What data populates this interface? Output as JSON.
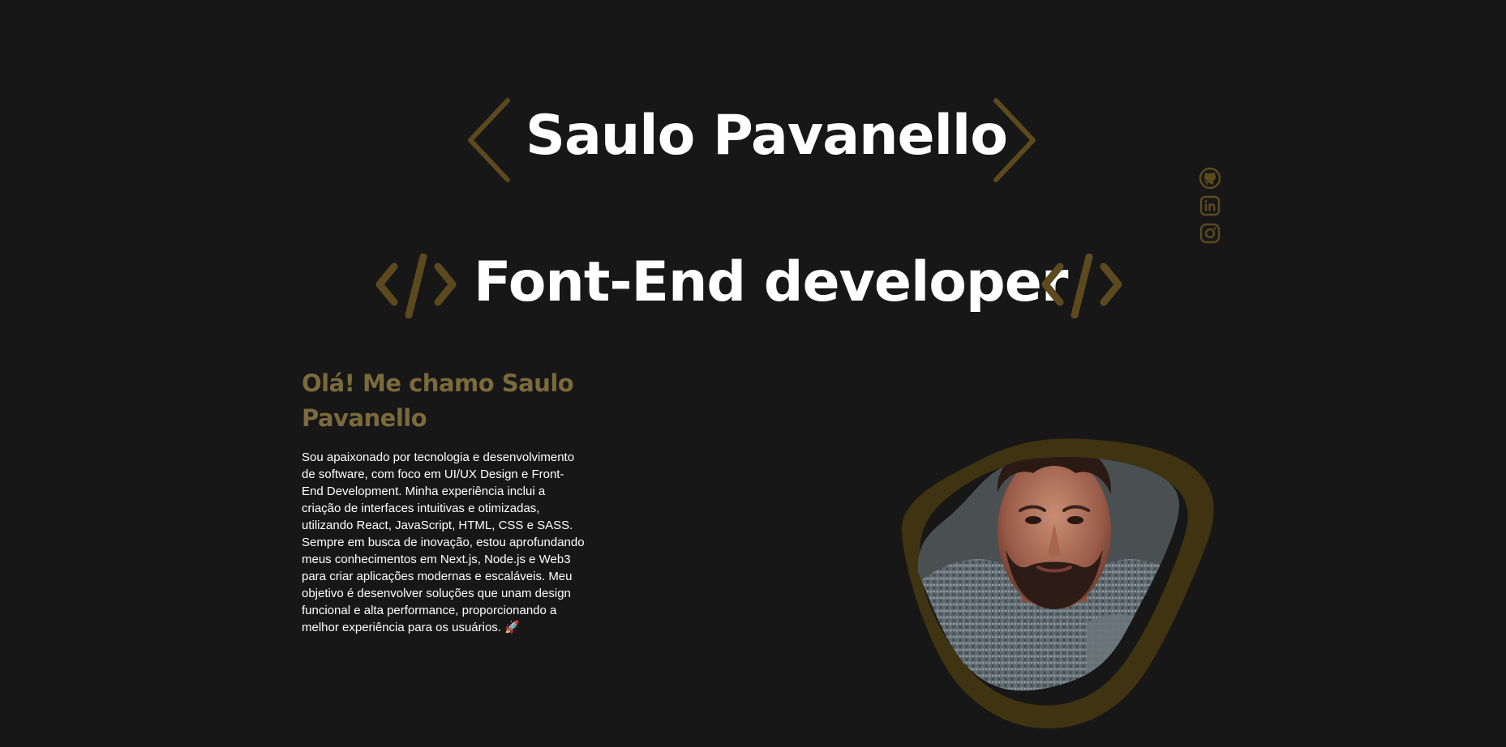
{
  "header": {
    "name": "Saulo Pavanello",
    "role": "Font-End developer"
  },
  "social": {
    "items": [
      {
        "icon": "github-icon"
      },
      {
        "icon": "linkedin-icon"
      },
      {
        "icon": "instagram-icon"
      }
    ]
  },
  "about": {
    "heading": "Olá! Me chamo Saulo Pavanello",
    "body": "Sou apaixonado por tecnologia e desenvolvimento de software, com foco em UI/UX Design e Front-End Development. Minha experiência inclui a criação de interfaces intuitivas e otimizadas, utilizando React, JavaScript, HTML, CSS e SASS. Sempre em busca de inovação, estou aprofundando meus conhecimentos em Next.js, Node.js e Web3 para criar aplicações modernas e escaláveis. Meu objetivo é desenvolver soluções que unam design funcional e alta performance, proporcionando a melhor experiência para os usuários. 🚀"
  },
  "colors": {
    "background": "#171717",
    "accent": "#5c4a1e",
    "heading_accent": "#7a6a3c",
    "text": "#ffffff"
  }
}
